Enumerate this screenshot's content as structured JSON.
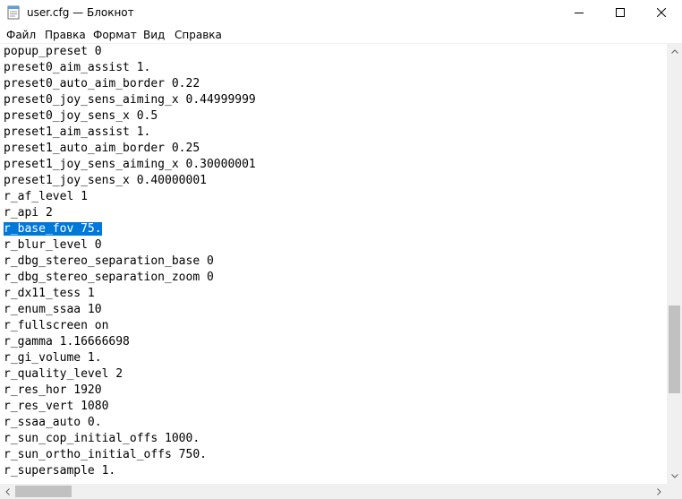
{
  "window": {
    "title": "user.cfg — Блокнот"
  },
  "menu": {
    "items": [
      "Файл",
      "Правка",
      "Формат",
      "Вид",
      "Справка"
    ]
  },
  "editor": {
    "lines": [
      {
        "text": "popup_preset 0",
        "selected": false
      },
      {
        "text": "preset0_aim_assist 1.",
        "selected": false
      },
      {
        "text": "preset0_auto_aim_border 0.22",
        "selected": false
      },
      {
        "text": "preset0_joy_sens_aiming_x 0.44999999",
        "selected": false
      },
      {
        "text": "preset0_joy_sens_x 0.5",
        "selected": false
      },
      {
        "text": "preset1_aim_assist 1.",
        "selected": false
      },
      {
        "text": "preset1_auto_aim_border 0.25",
        "selected": false
      },
      {
        "text": "preset1_joy_sens_aiming_x 0.30000001",
        "selected": false
      },
      {
        "text": "preset1_joy_sens_x 0.40000001",
        "selected": false
      },
      {
        "text": "r_af_level 1",
        "selected": false
      },
      {
        "text": "r_api 2",
        "selected": false
      },
      {
        "text": "r_base_fov 75.",
        "selected": true
      },
      {
        "text": "r_blur_level 0",
        "selected": false
      },
      {
        "text": "r_dbg_stereo_separation_base 0",
        "selected": false
      },
      {
        "text": "r_dbg_stereo_separation_zoom 0",
        "selected": false
      },
      {
        "text": "r_dx11_tess 1",
        "selected": false
      },
      {
        "text": "r_enum_ssaa 10",
        "selected": false
      },
      {
        "text": "r_fullscreen on",
        "selected": false
      },
      {
        "text": "r_gamma 1.16666698",
        "selected": false
      },
      {
        "text": "r_gi_volume 1.",
        "selected": false
      },
      {
        "text": "r_quality_level 2",
        "selected": false
      },
      {
        "text": "r_res_hor 1920",
        "selected": false
      },
      {
        "text": "r_res_vert 1080",
        "selected": false
      },
      {
        "text": "r_ssaa_auto 0.",
        "selected": false
      },
      {
        "text": "r_sun_cop_initial_offs 1000.",
        "selected": false
      },
      {
        "text": "r_sun_ortho_initial_offs 750.",
        "selected": false
      },
      {
        "text": "r_supersample 1.",
        "selected": false
      }
    ]
  },
  "colors": {
    "selection": "#0078d7",
    "scroll_thumb": "#c1c1c1"
  },
  "icons": {
    "app": "notepad-icon",
    "minimize": "minimize-icon",
    "maximize": "maximize-icon",
    "close": "close-icon"
  }
}
